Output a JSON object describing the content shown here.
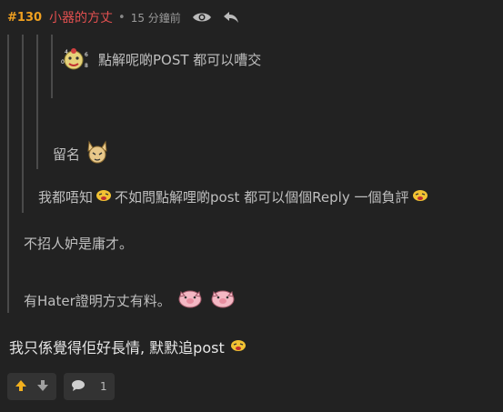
{
  "post": {
    "number": "#130",
    "username": "小器的方丈",
    "separator": "•",
    "time": "15 分鐘前"
  },
  "quotes": {
    "level4_text": "點解呢啲POST 都可以嘈交",
    "level3_text": "留名",
    "level2_text_a": "我都唔知",
    "level2_text_b": "不如問點解哩啲post 都可以個個Reply 一個負評",
    "level1_line1": "不招人妒是庸才。",
    "level1_line2": "有Hater證明方丈有料。"
  },
  "reply": {
    "text": "我只係覺得佢好長情, 默默追post"
  },
  "actions": {
    "comment_count": "1"
  }
}
